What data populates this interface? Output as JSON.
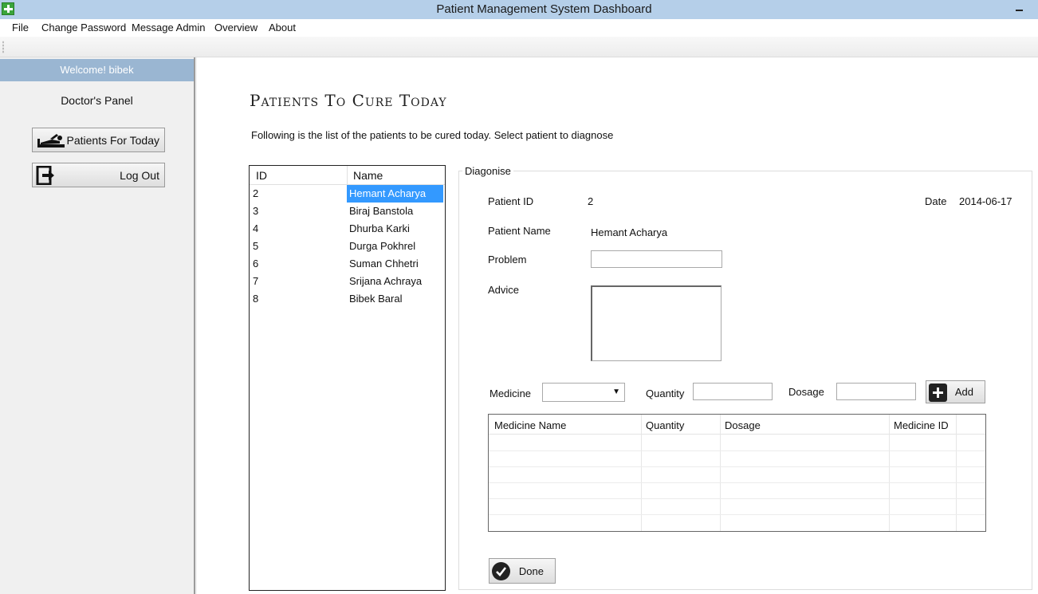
{
  "window": {
    "title": "Patient Management System Dashboard"
  },
  "menu": [
    "File",
    "Change Password",
    "Message Admin",
    "Overview",
    "About"
  ],
  "sidebar": {
    "welcome": "Welcome! bibek",
    "panel_title": "Doctor's Panel",
    "patients_button": "Patients For Today",
    "logout_button": "Log Out"
  },
  "main": {
    "heading": "Patients To Cure Today",
    "subtext": "Following is the list of the patients to be cured today. Select patient to diagnose",
    "list_headers": {
      "id": "ID",
      "name": "Name"
    },
    "patients": [
      {
        "id": "2",
        "name": "Hemant Acharya"
      },
      {
        "id": "3",
        "name": "Biraj Banstola"
      },
      {
        "id": "4",
        "name": "Dhurba Karki"
      },
      {
        "id": "5",
        "name": "Durga Pokhrel"
      },
      {
        "id": "6",
        "name": "Suman Chhetri"
      },
      {
        "id": "7",
        "name": "Srijana  Achraya"
      },
      {
        "id": "8",
        "name": "Bibek Baral"
      }
    ],
    "selected_patient_index": 0
  },
  "diagnose": {
    "group_title": "Diagonise",
    "patient_id_label": "Patient ID",
    "patient_id_value": "2",
    "date_label": "Date",
    "date_value": "2014-06-17",
    "patient_name_label": "Patient Name",
    "patient_name_value": "Hemant Acharya",
    "problem_label": "Problem",
    "problem_value": "",
    "advice_label": "Advice",
    "advice_value": "",
    "medicine_label": "Medicine",
    "medicine_selected": "",
    "quantity_label": "Quantity",
    "quantity_value": "",
    "dosage_label": "Dosage",
    "dosage_value": "",
    "add_button": "Add",
    "table_headers": [
      "Medicine Name",
      "Quantity",
      "Dosage",
      "Medicine ID"
    ],
    "done_button": "Done"
  },
  "colors": {
    "titlebar": "#b5cfe9",
    "welcome_bar": "#9ab6d2",
    "selection": "#3399ff"
  }
}
